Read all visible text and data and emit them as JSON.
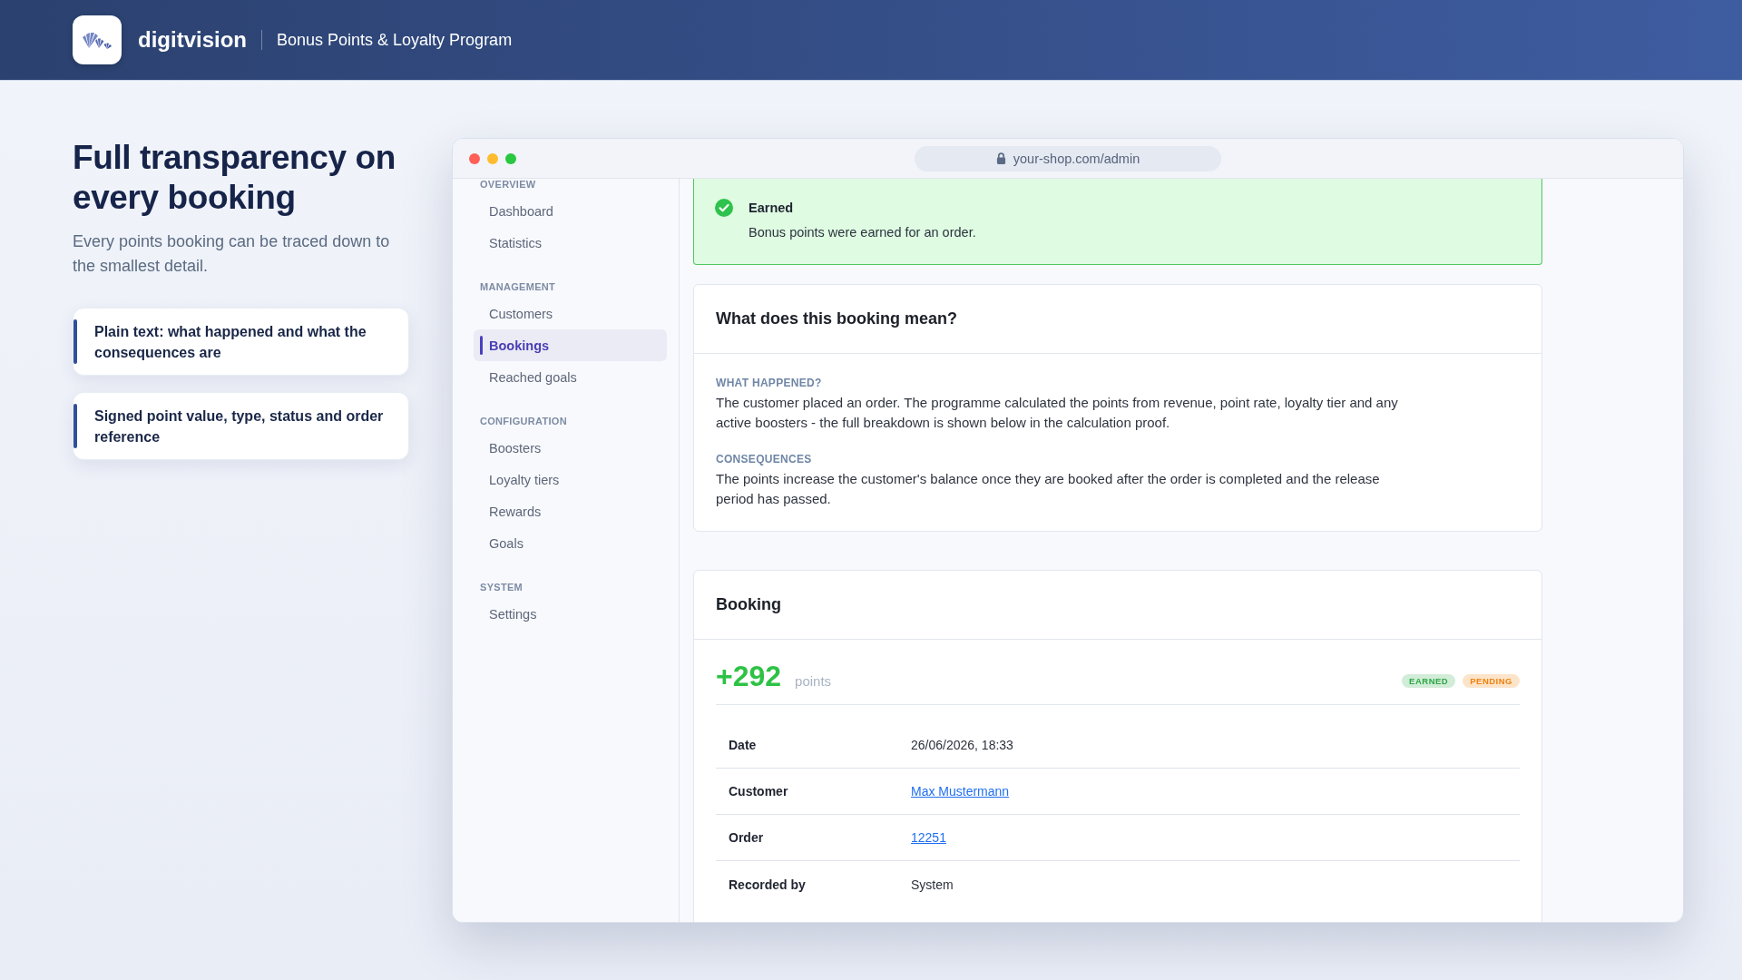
{
  "header": {
    "brand": "digitvision",
    "subtitle": "Bonus Points & Loyalty Program"
  },
  "intro": {
    "title": "Full transparency on every booking",
    "text": "Every points booking can be traced down to the smallest detail.",
    "features": [
      "Plain text: what happened and what the consequences are",
      "Signed point value, type, status and order reference"
    ]
  },
  "browser": {
    "url": "your-shop.com/admin"
  },
  "sidebar": {
    "sections": [
      {
        "label": "OVERVIEW",
        "items": [
          {
            "label": "Dashboard",
            "selected": false
          },
          {
            "label": "Statistics",
            "selected": false
          }
        ]
      },
      {
        "label": "MANAGEMENT",
        "items": [
          {
            "label": "Customers",
            "selected": false
          },
          {
            "label": "Bookings",
            "selected": true
          },
          {
            "label": "Reached goals",
            "selected": false
          }
        ]
      },
      {
        "label": "CONFIGURATION",
        "items": [
          {
            "label": "Boosters",
            "selected": false
          },
          {
            "label": "Loyalty tiers",
            "selected": false
          },
          {
            "label": "Rewards",
            "selected": false
          },
          {
            "label": "Goals",
            "selected": false
          }
        ]
      },
      {
        "label": "SYSTEM",
        "items": [
          {
            "label": "Settings",
            "selected": false
          }
        ]
      }
    ]
  },
  "status_banner": {
    "title": "Earned",
    "text": "Bonus points were earned for an order."
  },
  "explanation": {
    "title": "What does this booking mean?",
    "sections": [
      {
        "label": "WHAT HAPPENED?",
        "text": "The customer placed an order. The programme calculated the points from revenue, point rate, loyalty tier and any active boosters - the full breakdown is shown below in the calculation proof."
      },
      {
        "label": "CONSEQUENCES",
        "text": "The points increase the customer's balance once they are booked after the order is completed and the release period has passed."
      }
    ]
  },
  "booking": {
    "title": "Booking",
    "points": "+292",
    "unit": "points",
    "badges": [
      {
        "label": "EARNED",
        "color": "#2ea847"
      },
      {
        "label": "PENDING",
        "color": "#f0820f"
      }
    ],
    "rows": [
      {
        "label": "Date",
        "value": "26/06/2026, 18:33",
        "kind": "text"
      },
      {
        "label": "Customer",
        "value": "Max Mustermann",
        "kind": "link"
      },
      {
        "label": "Order",
        "value": "12251",
        "kind": "link"
      },
      {
        "label": "Recorded by",
        "value": "System",
        "kind": "text"
      }
    ]
  }
}
